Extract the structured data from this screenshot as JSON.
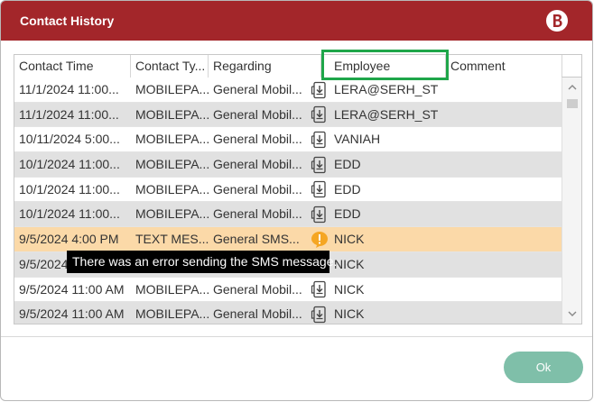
{
  "window": {
    "title": "Contact History",
    "logo_icon": "brand-b-logo",
    "title_bar_color": "#a3262a"
  },
  "grid": {
    "columns": [
      "Contact Time",
      "Contact Ty...",
      "Regarding",
      "Employee",
      "Comment"
    ],
    "rows": [
      {
        "time": "11/1/2024 11:00...",
        "type": "MOBILEPA...",
        "regarding": "General Mobil...",
        "icon": "phone-download-icon",
        "employee": "LERA@SERH_ST",
        "comment": ""
      },
      {
        "time": "11/1/2024 11:00...",
        "type": "MOBILEPA...",
        "regarding": "General Mobil...",
        "icon": "phone-download-icon",
        "employee": "LERA@SERH_ST",
        "comment": ""
      },
      {
        "time": "10/11/2024 5:00...",
        "type": "MOBILEPA...",
        "regarding": "General Mobil...",
        "icon": "phone-download-icon",
        "employee": "VANIAH",
        "comment": ""
      },
      {
        "time": "10/1/2024 11:00...",
        "type": "MOBILEPA...",
        "regarding": "General Mobil...",
        "icon": "phone-download-icon",
        "employee": "EDD",
        "comment": ""
      },
      {
        "time": "10/1/2024 11:00...",
        "type": "MOBILEPA...",
        "regarding": "General Mobil...",
        "icon": "phone-download-icon",
        "employee": "EDD",
        "comment": ""
      },
      {
        "time": "10/1/2024 11:00...",
        "type": "MOBILEPA...",
        "regarding": "General Mobil...",
        "icon": "phone-download-icon",
        "employee": "EDD",
        "comment": ""
      },
      {
        "time": "9/5/2024 4:00 PM",
        "type": "TEXT MES...",
        "regarding": "General SMS...",
        "icon": "warning-icon",
        "employee": "NICK",
        "comment": ""
      },
      {
        "time": "9/5/2024",
        "type": "",
        "regarding": "",
        "icon": "",
        "employee": "NICK",
        "comment": ""
      },
      {
        "time": "9/5/2024 11:00 AM",
        "type": "MOBILEPA...",
        "regarding": "General Mobil...",
        "icon": "phone-download-icon",
        "employee": "NICK",
        "comment": ""
      },
      {
        "time": "9/5/2024 11:00 AM",
        "type": "MOBILEPA...",
        "regarding": "General Mobil...",
        "icon": "phone-download-icon",
        "employee": "NICK",
        "comment": ""
      }
    ],
    "selected_row": 6
  },
  "tooltip": {
    "text": "There was an error sending the SMS message."
  },
  "footer": {
    "ok_label": "Ok",
    "ok_color": "#7fbfa9"
  },
  "highlight_color": "#1fa64a",
  "selected_row_color": "#fbd9a8",
  "warning_color": "#f5a623"
}
